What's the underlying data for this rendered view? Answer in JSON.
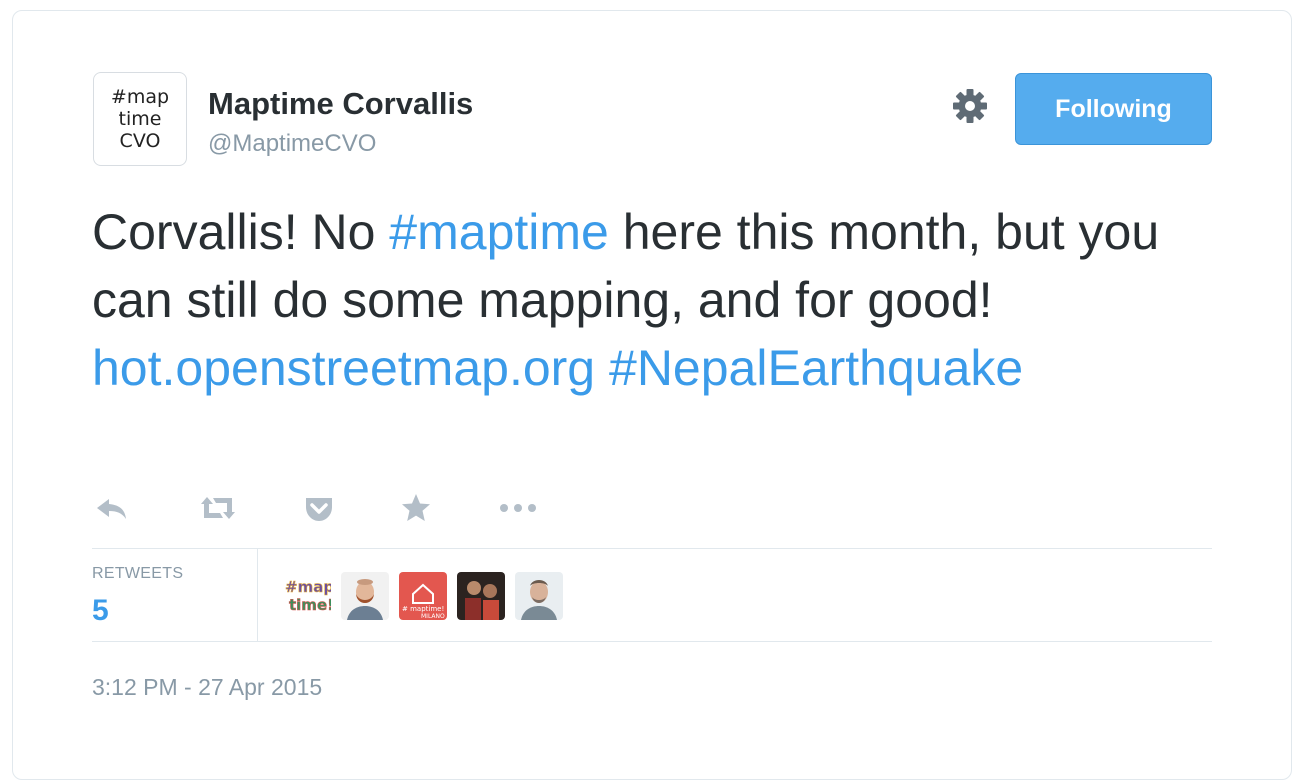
{
  "account": {
    "avatar_lines": [
      "#map",
      "time",
      "CVO"
    ],
    "display_name": "Maptime Corvallis",
    "handle": "@MaptimeCVO"
  },
  "header": {
    "gear_icon": "gear-icon",
    "follow_label": "Following",
    "follow_color": "#55acee"
  },
  "tweet": {
    "segments": [
      {
        "text": "Corvallis! No ",
        "kind": "text"
      },
      {
        "text": "#maptime",
        "kind": "link"
      },
      {
        "text": " here this month, but you can still do some mapping, and  for good! ",
        "kind": "text"
      },
      {
        "text": "hot.openstreetmap.org",
        "kind": "link"
      },
      {
        "text": " ",
        "kind": "text"
      },
      {
        "text": "#NepalEarthquake",
        "kind": "link"
      }
    ],
    "link_color": "#3b9be9"
  },
  "actions": [
    {
      "name": "reply",
      "icon": "reply-icon"
    },
    {
      "name": "retweet",
      "icon": "retweet-icon"
    },
    {
      "name": "pocket",
      "icon": "pocket-icon"
    },
    {
      "name": "favorite",
      "icon": "star-icon"
    },
    {
      "name": "more",
      "icon": "more-icon"
    }
  ],
  "stats": {
    "label": "RETWEETS",
    "count": "5",
    "retweeters": [
      {
        "avatar": "maptime-logo-avatar"
      },
      {
        "avatar": "bearded-man-avatar"
      },
      {
        "avatar": "maptime-milano-avatar",
        "badge_text": "# maptime!",
        "sub_text": "MILANO"
      },
      {
        "avatar": "people-photo-avatar"
      },
      {
        "avatar": "man-portrait-avatar"
      }
    ]
  },
  "timestamp": "3:12 PM - 27 Apr 2015"
}
